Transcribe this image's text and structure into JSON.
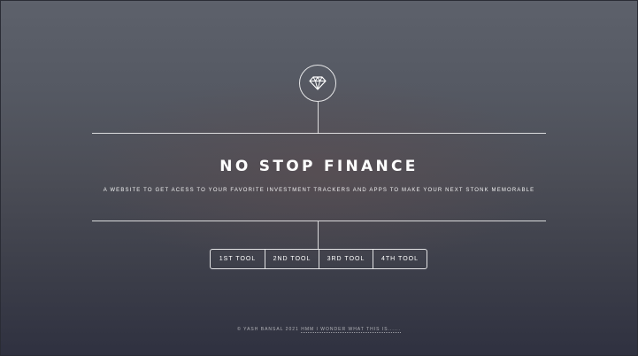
{
  "header": {
    "logo_icon": "diamond-icon",
    "title": "NO STOP FINANCE",
    "tagline": "A WEBSITE TO GET ACESS TO YOUR FAVORITE INVESTMENT TRACKERS AND APPS TO MAKE YOUR NEXT STONK MEMORABLE"
  },
  "nav": {
    "items": [
      {
        "label": "1ST TOOL"
      },
      {
        "label": "2ND TOOL"
      },
      {
        "label": "3RD TOOL"
      },
      {
        "label": "4TH TOOL"
      }
    ]
  },
  "footer": {
    "copyright": "© YASH BANSAL 2021",
    "separator": " ",
    "link": "HMM I WONDER WHAT THIS IS......"
  }
}
